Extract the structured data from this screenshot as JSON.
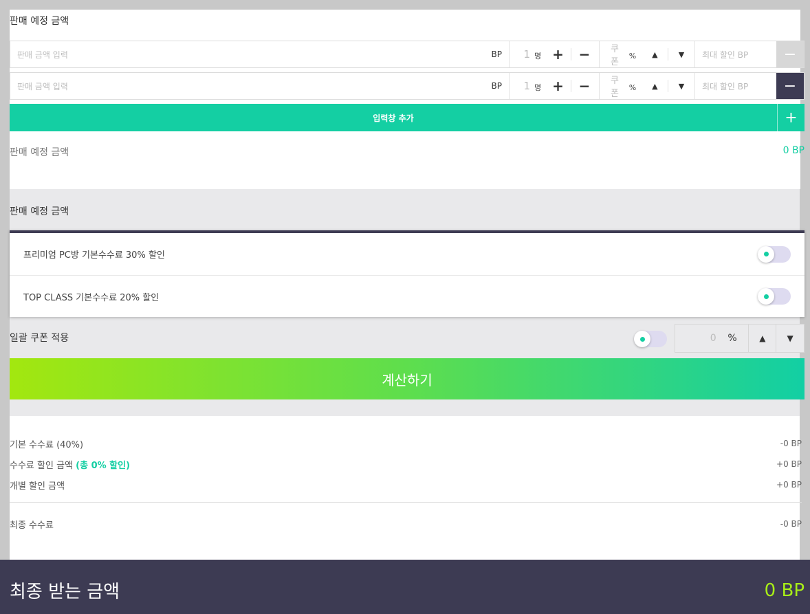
{
  "section1": {
    "title": "판매 예정 금액",
    "rows": [
      {
        "amount_placeholder": "판매 금액 입력",
        "amount_unit": "BP",
        "people_count": "1",
        "people_unit": "명",
        "plus": "+",
        "minus": "−",
        "coupon_placeholder": "쿠폰",
        "coupon_unit": "%",
        "max_discount_placeholder": "최대 할인 BP",
        "remove": "−",
        "remove_state": "disabled"
      },
      {
        "amount_placeholder": "판매 금액 입력",
        "amount_unit": "BP",
        "people_count": "1",
        "people_unit": "명",
        "plus": "+",
        "minus": "−",
        "coupon_placeholder": "쿠폰",
        "coupon_unit": "%",
        "max_discount_placeholder": "최대 할인 BP",
        "remove": "−",
        "remove_state": "active"
      }
    ],
    "add_button": "입력창 추가",
    "add_icon": "+",
    "summary_label": "판매 예정 금액",
    "summary_value": "0 BP"
  },
  "section2": {
    "title": "판매 예정 금액",
    "discounts": [
      {
        "label": "프리미엄 PC방 기본수수료 30% 할인",
        "on": false
      },
      {
        "label": "TOP CLASS 기본수수료 20% 할인",
        "on": false
      }
    ],
    "bulk_coupon_label": "일괄 쿠폰 적용",
    "bulk_coupon_value": "0",
    "bulk_coupon_unit": "%",
    "calculate_button": "계산하기"
  },
  "breakdown": {
    "base_fee_label": "기본 수수료 (40%)",
    "base_fee_value": "-0 BP",
    "fee_discount_label": "수수료 할인 금액",
    "fee_discount_highlight": "(총 0% 할인)",
    "fee_discount_value": "+0 BP",
    "individual_discount_label": "개별 할인 금액",
    "individual_discount_value": "+0 BP",
    "final_fee_label": "최종 수수료",
    "final_fee_value": "-0 BP"
  },
  "footer": {
    "label": "최종 받는 금액",
    "value": "0 BP"
  },
  "colors": {
    "accent": "#14cfa3",
    "dark": "#3d3b53",
    "lime": "#a8ee18"
  }
}
